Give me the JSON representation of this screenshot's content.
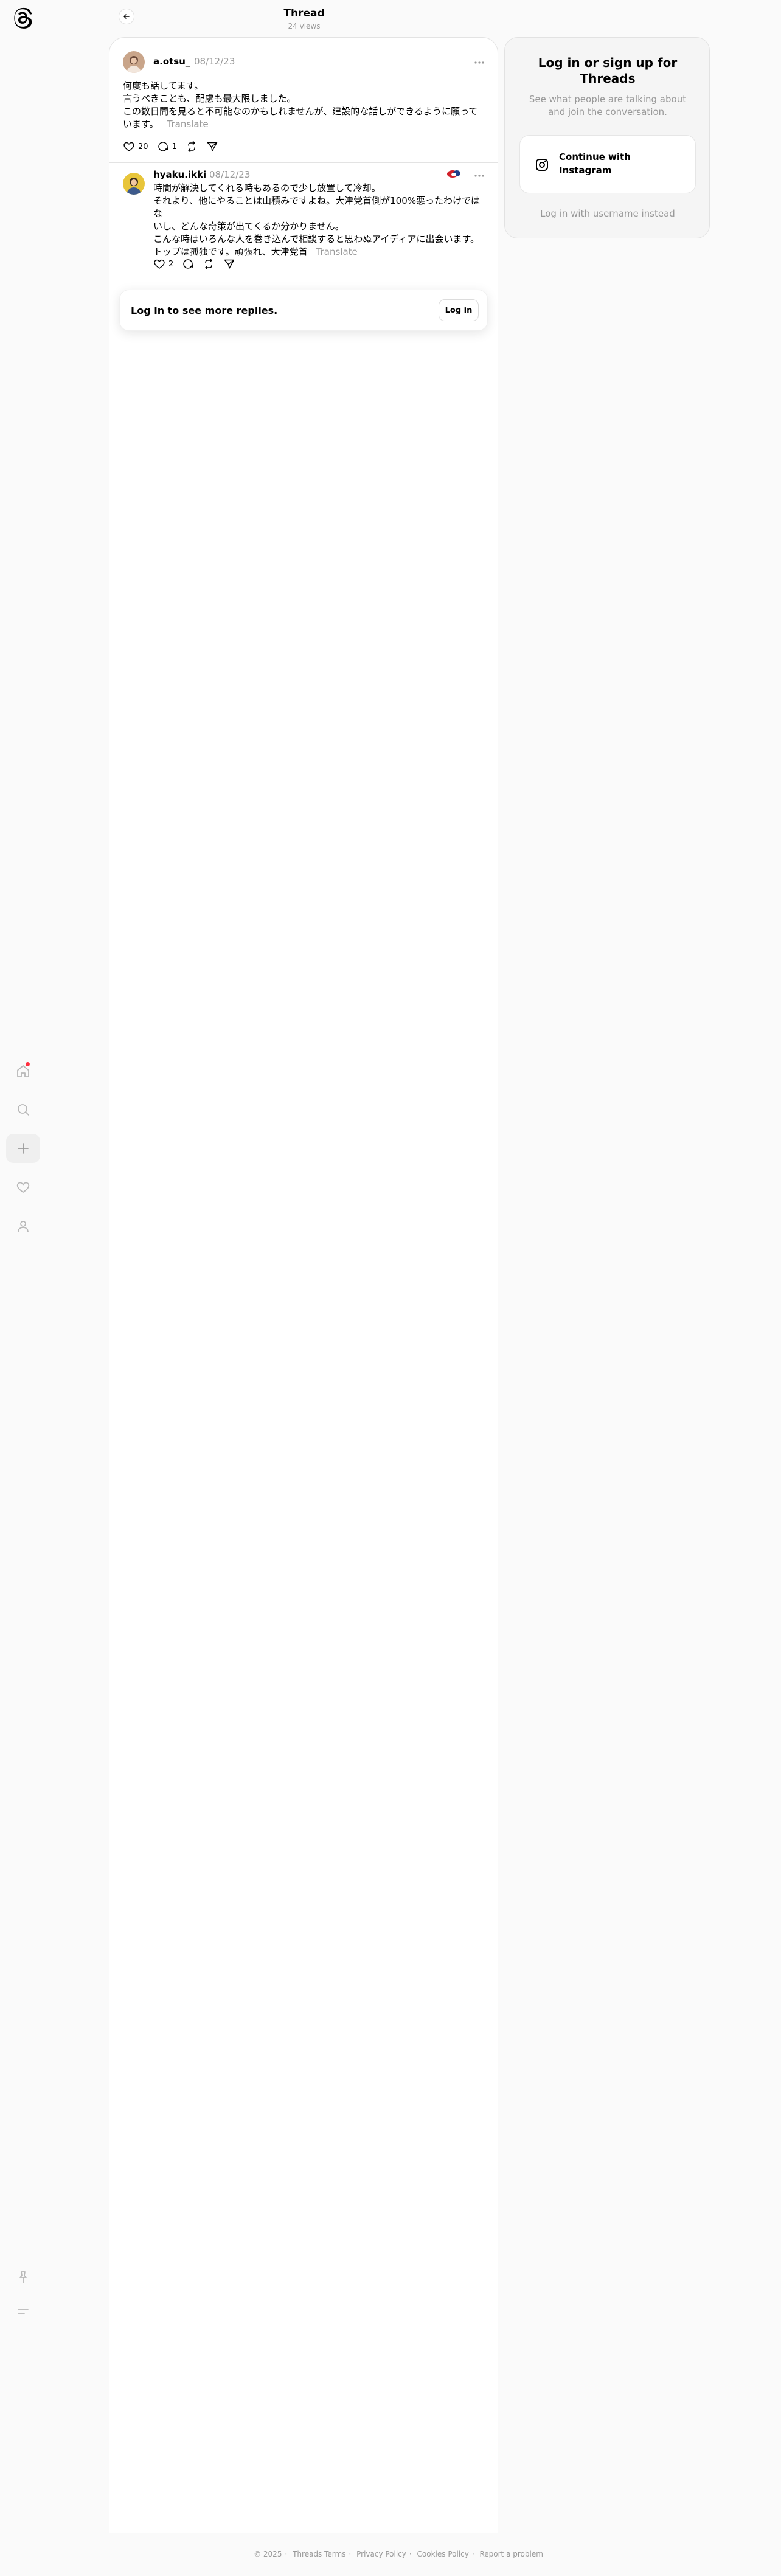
{
  "nav": {
    "logo": "threads-logo",
    "items": [
      {
        "icon": "home-icon",
        "has_badge": true
      },
      {
        "icon": "search-icon"
      },
      {
        "icon": "create-icon"
      },
      {
        "icon": "heart-icon"
      },
      {
        "icon": "profile-icon"
      }
    ],
    "bottom": [
      {
        "icon": "pin-icon"
      },
      {
        "icon": "menu-icon"
      }
    ]
  },
  "header": {
    "title": "Thread",
    "subtitle": "24 views"
  },
  "posts": [
    {
      "username": "a.otsu_",
      "date": "08/12/23",
      "text": "何度も話してます。\n言うべきことも、配慮も最大限しました。\nこの数日間を見ると不可能なのかもしれませんが、建設的な話しができるように願って\nいます。",
      "translate": "Translate",
      "likes": "20",
      "replies": "1"
    },
    {
      "username": "hyaku.ikki",
      "date": "08/12/23",
      "text": "時間が解決してくれる時もあるので少し放置して冷却。\nそれより、他にやることは山積みですよね。大津党首側が100%悪ったわけではな\nいし、どんな奇策が出てくるか分かりません。\nこんな時はいろんな人を巻き込んで相談すると思わぬアイディアに出会います。\nトップは孤独です。頑張れ、大津党首",
      "translate": "Translate",
      "likes": "2",
      "replies": ""
    }
  ],
  "login_prompt": {
    "text": "Log in to see more replies.",
    "button": "Log in"
  },
  "login_card": {
    "title": "Log in or sign up for Threads",
    "subtitle": "See what people are talking about and join the conversation.",
    "instagram_button": "Continue with Instagram",
    "alt_login": "Log in with username instead"
  },
  "footer": {
    "copyright": "© 2025",
    "links": [
      "Threads Terms",
      "Privacy Policy",
      "Cookies Policy",
      "Report a problem"
    ]
  },
  "colors": {
    "background": "#fafafa",
    "muted_text": "#999999",
    "notification": "#ff3040"
  }
}
